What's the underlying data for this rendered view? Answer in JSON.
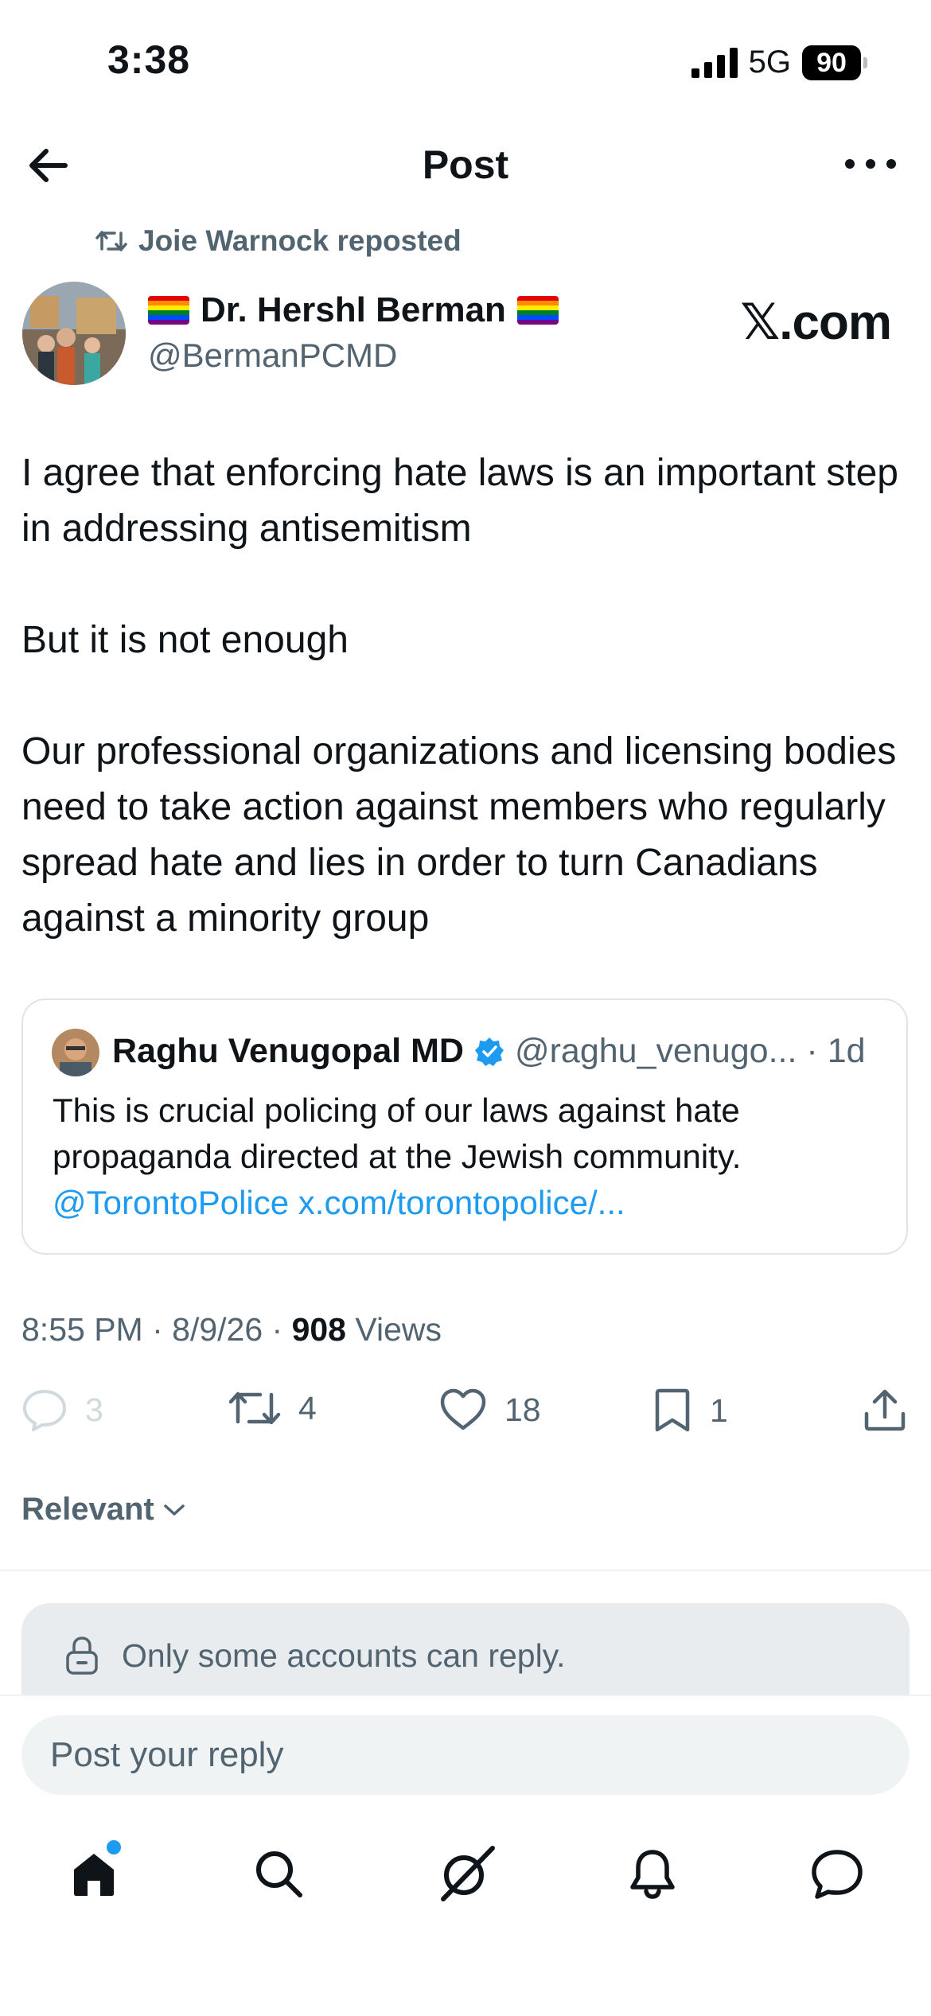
{
  "status_bar": {
    "time": "3:38",
    "network": "5G",
    "battery": "90"
  },
  "header": {
    "title": "Post"
  },
  "repost": {
    "text": "Joie Warnock reposted"
  },
  "author": {
    "name": "Dr. Hershl Berman",
    "handle": "@BermanPCMD",
    "source_badge": "𝕏.com"
  },
  "post": {
    "text": "I agree that enforcing hate laws is an important step in addressing antisemitism\n\nBut it is not enough\n\nOur professional organizations and licensing bodies need to take action against members who regularly spread hate and lies in order to turn Canadians against a minority group"
  },
  "quote": {
    "name": "Raghu Venugopal MD",
    "handle": "@raghu_venugo...",
    "time": "· 1d",
    "text": "This is crucial policing of our laws against hate propaganda directed at the Jewish community.",
    "mention": "@TorontoPolice",
    "link": "x.com/torontopolice/..."
  },
  "meta": {
    "time": "8:55 PM",
    "date": "8/9/26",
    "views_count": "908",
    "views_label": "Views"
  },
  "actions": {
    "replies": "3",
    "reposts": "4",
    "likes": "18",
    "bookmarks": "1"
  },
  "sort": {
    "label": "Relevant"
  },
  "reply_restriction": "Only some accounts can reply.",
  "reply_input": {
    "placeholder": "Post your reply"
  },
  "colors": {
    "accent": "#1d9bf0",
    "muted": "#536471",
    "text": "#0f1419"
  },
  "nav": [
    "home-icon",
    "search-icon",
    "grok-icon",
    "notifications-icon",
    "messages-icon"
  ]
}
